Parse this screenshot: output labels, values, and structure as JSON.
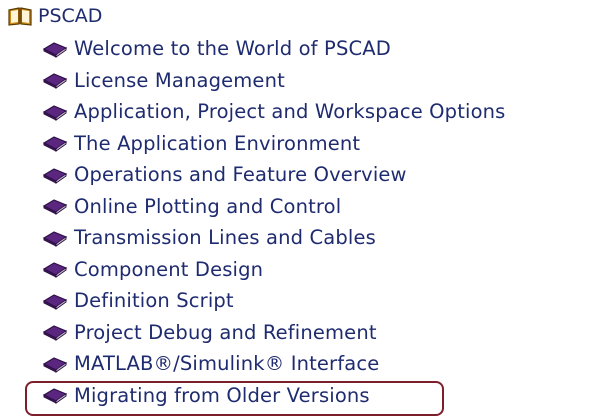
{
  "tree": {
    "root": {
      "label": "PSCAD",
      "icon": "open-book-icon"
    },
    "items": [
      {
        "label": "Welcome to the World of PSCAD",
        "icon": "closed-book-icon"
      },
      {
        "label": "License Management",
        "icon": "closed-book-icon"
      },
      {
        "label": "Application, Project and Workspace Options",
        "icon": "closed-book-icon"
      },
      {
        "label": "The Application Environment",
        "icon": "closed-book-icon"
      },
      {
        "label": "Operations and Feature Overview",
        "icon": "closed-book-icon"
      },
      {
        "label": "Online Plotting and Control",
        "icon": "closed-book-icon"
      },
      {
        "label": "Transmission Lines and Cables",
        "icon": "closed-book-icon"
      },
      {
        "label": "Component Design",
        "icon": "closed-book-icon"
      },
      {
        "label": "Definition Script",
        "icon": "closed-book-icon"
      },
      {
        "label": "Project Debug and Refinement",
        "icon": "closed-book-icon"
      },
      {
        "label": "MATLAB®/Simulink® Interface",
        "icon": "closed-book-icon"
      },
      {
        "label": "Migrating from Older Versions",
        "icon": "closed-book-icon",
        "highlighted": true
      }
    ]
  },
  "colors": {
    "text": "#1f2b6f",
    "book_cover": "#4b1f6f",
    "book_pages": "#ffffff",
    "highlight_border": "#7d1e2b"
  }
}
